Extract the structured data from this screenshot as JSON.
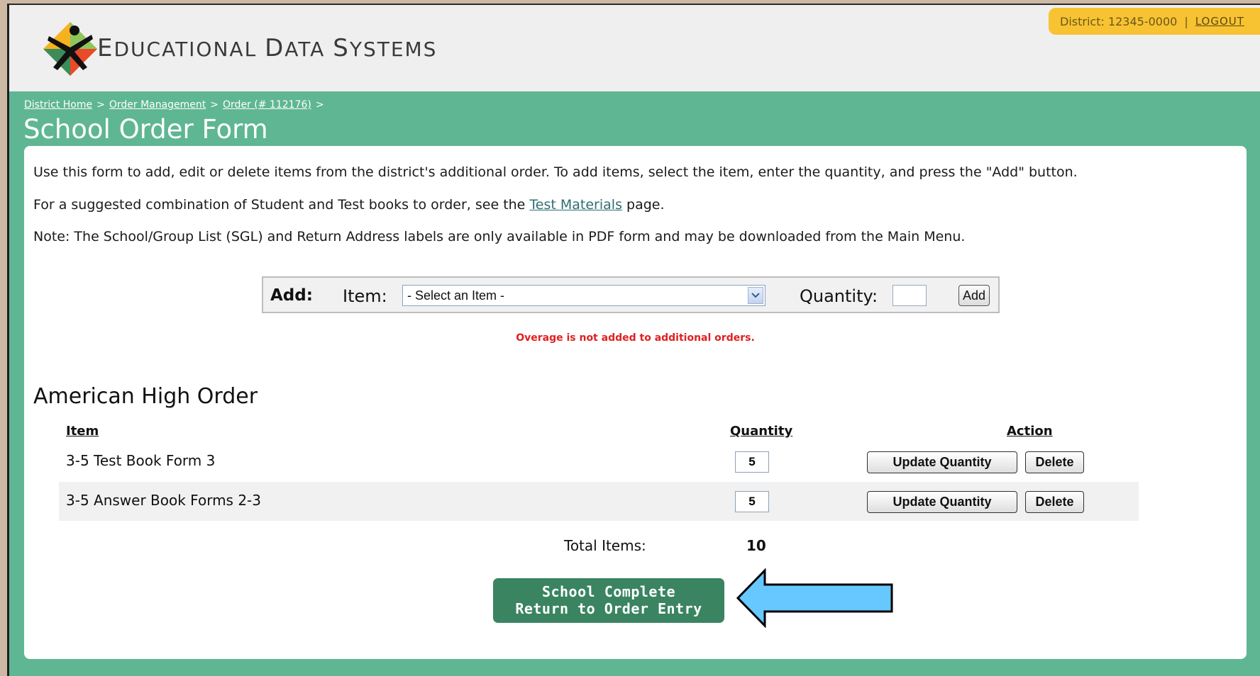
{
  "header": {
    "brand_parts": [
      {
        "big": "E",
        "rest": "DUCATIONAL"
      },
      {
        "big": "D",
        "rest": "ATA"
      },
      {
        "big": "S",
        "rest": "YSTEMS"
      }
    ],
    "district": "District: 12345-0000",
    "separator": "|",
    "logout": "LOGOUT"
  },
  "breadcrumb": {
    "district_home": "District Home",
    "order_management": "Order Management",
    "order": "Order (# 112176)",
    "sep": ">"
  },
  "page_title": "School Order Form",
  "intro": {
    "line1": "Use this form to add, edit or delete items from the district's additional order. To add items, select the item, enter the quantity, and press the \"Add\" button.",
    "line2_prefix": "For a suggested combination of Student and Test books to order, see the ",
    "line2_link": "Test Materials",
    "line2_suffix": " page.",
    "line3": "Note: The School/Group List (SGL) and Return Address labels are only available in PDF form and may be downloaded from the Main Menu."
  },
  "add_form": {
    "add_label": "Add:",
    "item_label": "Item:",
    "select_value": "- Select an Item -",
    "quantity_label": "Quantity:",
    "quantity_value": "",
    "add_button": "Add"
  },
  "overage_note": "Overage is not added to additional orders.",
  "order": {
    "title": "American High Order",
    "columns": {
      "item": "Item",
      "quantity": "Quantity",
      "action": "Action"
    },
    "rows": [
      {
        "item": "3-5 Test Book Form 3",
        "quantity": "5",
        "update": "Update Quantity",
        "delete": "Delete"
      },
      {
        "item": "3-5 Answer Book Forms 2-3",
        "quantity": "5",
        "update": "Update Quantity",
        "delete": "Delete"
      }
    ],
    "total_label": "Total Items:",
    "total_value": "10"
  },
  "complete_button": {
    "line1": "School Complete",
    "line2": "Return to Order Entry"
  },
  "colors": {
    "brand_green": "#5fb693",
    "button_green": "#3a8461",
    "district_tab": "#f7c333",
    "overage_red": "#e02020",
    "arrow_blue": "#66c8ff"
  }
}
